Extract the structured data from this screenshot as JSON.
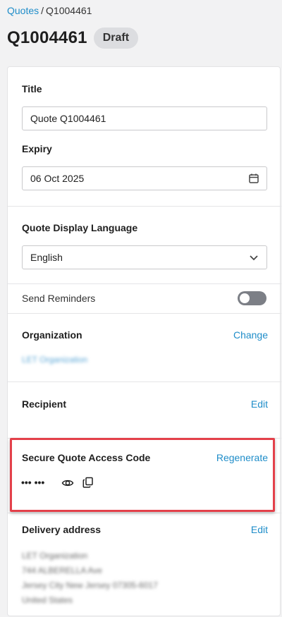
{
  "breadcrumb": {
    "parent": "Quotes",
    "separator": "/",
    "current": "Q1004461"
  },
  "header": {
    "title": "Q1004461",
    "status": "Draft"
  },
  "form": {
    "title_label": "Title",
    "title_value": "Quote Q1004461",
    "expiry_label": "Expiry",
    "expiry_value": "06 Oct 2025",
    "language_label": "Quote Display Language",
    "language_value": "English",
    "reminders_label": "Send Reminders",
    "reminders_on": false
  },
  "organization": {
    "label": "Organization",
    "action": "Change",
    "name": "LET Organization"
  },
  "recipient": {
    "label": "Recipient",
    "action": "Edit"
  },
  "access_code": {
    "label": "Secure Quote Access Code",
    "action": "Regenerate",
    "masked": "••• •••"
  },
  "delivery": {
    "label": "Delivery address",
    "action": "Edit",
    "lines": [
      "LET Organization",
      "744 ALBERELLA Ave",
      "Jersey City New Jersey 07305-6017",
      "United States"
    ]
  },
  "colors": {
    "link": "#1f8dc9",
    "highlight": "#e3404a",
    "badge_bg": "#dcdde0",
    "toggle_off": "#7c7f86"
  },
  "icons": {
    "date": "calendar-icon",
    "dropdown": "chevron-down-icon",
    "show": "eye-icon",
    "copy": "copy-icon"
  }
}
